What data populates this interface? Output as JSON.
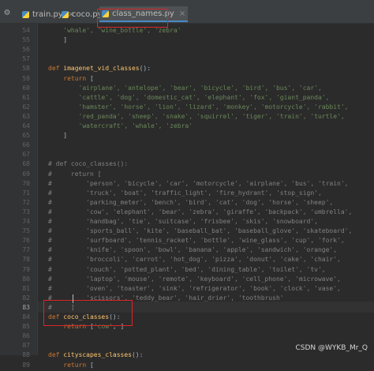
{
  "tabs": [
    {
      "label": "train.py",
      "icon": "python-file-icon",
      "close": "×"
    },
    {
      "label": "coco.py",
      "icon": "python-file-icon",
      "close": "×"
    },
    {
      "label": "class_names.py",
      "icon": "python-file-icon",
      "close": "×",
      "active": true
    }
  ],
  "toolbar": {
    "gear": "⚙"
  },
  "code_lines": [
    {
      "n": "54",
      "segs": [
        [
          "str",
          "    'whale', 'wine_bottle', 'zebra'"
        ]
      ]
    },
    {
      "n": "55",
      "segs": [
        [
          "plain",
          "    ]"
        ]
      ]
    },
    {
      "n": "56",
      "segs": []
    },
    {
      "n": "57",
      "segs": []
    },
    {
      "n": "58",
      "segs": [
        [
          "kw",
          "def "
        ],
        [
          "fn",
          "imagenet_vid_classes"
        ],
        [
          "plain",
          "():"
        ]
      ]
    },
    {
      "n": "59",
      "segs": [
        [
          "kw",
          "    return "
        ],
        [
          "plain",
          "["
        ]
      ]
    },
    {
      "n": "60",
      "segs": [
        [
          "str",
          "        'airplane', 'antelope', 'bear', 'bicycle', 'bird', 'bus', 'car',"
        ]
      ]
    },
    {
      "n": "61",
      "segs": [
        [
          "str",
          "        'cattle', 'dog', 'domestic_cat', 'elephant', 'fox', 'giant_panda',"
        ]
      ]
    },
    {
      "n": "62",
      "segs": [
        [
          "str",
          "        'hamster', 'horse', 'lion', 'lizard', 'monkey', 'motorcycle', 'rabbit',"
        ]
      ]
    },
    {
      "n": "63",
      "segs": [
        [
          "str",
          "        'red_panda', 'sheep', 'snake', 'squirrel', 'tiger', 'train', 'turtle',"
        ]
      ]
    },
    {
      "n": "64",
      "segs": [
        [
          "str",
          "        'watercraft', 'whale', 'zebra'"
        ]
      ]
    },
    {
      "n": "65",
      "segs": [
        [
          "plain",
          "    ]"
        ]
      ]
    },
    {
      "n": "66",
      "segs": []
    },
    {
      "n": "67",
      "segs": []
    },
    {
      "n": "68",
      "segs": [
        [
          "cm",
          "# def coco_classes():"
        ]
      ]
    },
    {
      "n": "69",
      "segs": [
        [
          "cm",
          "#     return ["
        ]
      ]
    },
    {
      "n": "70",
      "segs": [
        [
          "cm",
          "#         'person', 'bicycle', 'car', 'motorcycle', 'airplane', 'bus', 'train',"
        ]
      ]
    },
    {
      "n": "71",
      "segs": [
        [
          "cm",
          "#         'truck', 'boat', 'traffic_light', 'fire_hydrant', 'stop_sign',"
        ]
      ]
    },
    {
      "n": "72",
      "segs": [
        [
          "cm",
          "#         'parking_meter', 'bench', 'bird', 'cat', 'dog', 'horse', 'sheep',"
        ]
      ]
    },
    {
      "n": "73",
      "segs": [
        [
          "cm",
          "#         'cow', 'elephant', 'bear', 'zebra', 'giraffe', 'backpack', 'umbrella',"
        ]
      ]
    },
    {
      "n": "74",
      "segs": [
        [
          "cm",
          "#         'handbag', 'tie', 'suitcase', 'frisbee', 'skis', 'snowboard',"
        ]
      ]
    },
    {
      "n": "75",
      "segs": [
        [
          "cm",
          "#         'sports_ball', 'kite', 'baseball_bat', 'baseball_glove', 'skateboard',"
        ]
      ]
    },
    {
      "n": "76",
      "segs": [
        [
          "cm",
          "#         'surfboard', 'tennis_racket', 'bottle', 'wine_glass', 'cup', 'fork',"
        ]
      ]
    },
    {
      "n": "77",
      "segs": [
        [
          "cm",
          "#         'knife', 'spoon', 'bowl', 'banana', 'apple', 'sandwich', 'orange',"
        ]
      ]
    },
    {
      "n": "78",
      "segs": [
        [
          "cm",
          "#         'broccoli', 'carrot', 'hot_dog', 'pizza', 'donut', 'cake', 'chair',"
        ]
      ]
    },
    {
      "n": "79",
      "segs": [
        [
          "cm",
          "#         'couch', 'potted_plant', 'bed', 'dining_table', 'toilet', 'tv',"
        ]
      ]
    },
    {
      "n": "80",
      "segs": [
        [
          "cm",
          "#         'laptop', 'mouse', 'remote', 'keyboard', 'cell_phone', 'microwave',"
        ]
      ]
    },
    {
      "n": "81",
      "segs": [
        [
          "cm",
          "#         'oven', 'toaster', 'sink', 'refrigerator', 'book', 'clock', 'vase',"
        ]
      ]
    },
    {
      "n": "82",
      "segs": [
        [
          "cm",
          "#         'scissors', 'teddy_bear', 'hair_drier', 'toothbrush'"
        ]
      ]
    },
    {
      "n": "83",
      "segs": [
        [
          "cm",
          "#     ]"
        ]
      ],
      "current": true
    },
    {
      "n": "84",
      "segs": [
        [
          "kw",
          "def "
        ],
        [
          "fn",
          "coco_classes"
        ],
        [
          "plain",
          "():"
        ]
      ]
    },
    {
      "n": "85",
      "segs": [
        [
          "kw",
          "    return "
        ],
        [
          "plain",
          "["
        ],
        [
          "str",
          "'cow'"
        ],
        [
          "plain",
          ", ]"
        ]
      ]
    },
    {
      "n": "86",
      "segs": []
    },
    {
      "n": "87",
      "segs": []
    },
    {
      "n": "88",
      "segs": [
        [
          "kw",
          "def "
        ],
        [
          "fn",
          "cityscapes_classes"
        ],
        [
          "plain",
          "():"
        ]
      ]
    },
    {
      "n": "89",
      "segs": [
        [
          "kw",
          "    return "
        ],
        [
          "plain",
          "["
        ]
      ]
    }
  ],
  "watermark": "CSDN @WYKB_Mr_Q"
}
